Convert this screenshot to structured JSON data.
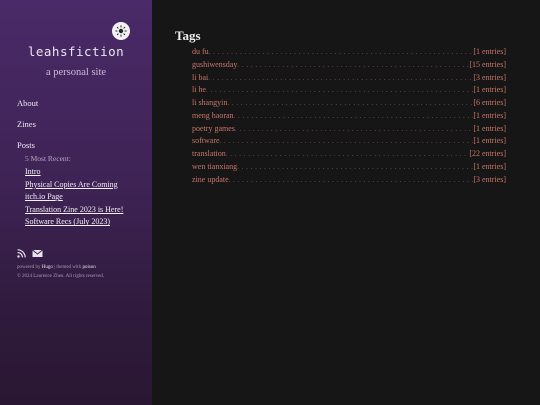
{
  "sidebar": {
    "site_title": "leahsfiction",
    "subtitle": "a personal site",
    "nav": {
      "about": "About",
      "zines": "Zines",
      "posts": "Posts"
    },
    "recent_label": "5 Most Recent:",
    "recent": [
      "Intro",
      "Physical Copies Are Coming",
      "itch.io Page",
      "Translation Zine 2023 is Here!",
      "Software Recs (July 2023)"
    ],
    "social_icons": [
      "rss-icon",
      "email-icon"
    ],
    "footer": {
      "powered_by": "powered by",
      "hugo": "Hugo",
      "themed_with": "| themed with",
      "poison": "poison",
      "copyright": "© 2024 Laurence Zhen. All rights reserved."
    }
  },
  "main": {
    "title": "Tags",
    "tags": [
      {
        "name": "du fu",
        "count": "[1 entries]"
      },
      {
        "name": "gushiwensday",
        "count": "[15 entries]"
      },
      {
        "name": "li bai",
        "count": "[3 entries]"
      },
      {
        "name": "li he",
        "count": "[1 entries]"
      },
      {
        "name": "li shangyin",
        "count": "[6 entries]"
      },
      {
        "name": "meng haoran",
        "count": "[1 entries]"
      },
      {
        "name": "poetry games",
        "count": "[1 entries]"
      },
      {
        "name": "software",
        "count": "[1 entries]"
      },
      {
        "name": "translation",
        "count": "[22 entries]"
      },
      {
        "name": "wen tianxiang",
        "count": "[1 entries]"
      },
      {
        "name": "zine update",
        "count": "[3 entries]"
      }
    ]
  },
  "colors": {
    "sidebar_top": "#4a2a68",
    "sidebar_bottom": "#2a1733",
    "background": "#161616",
    "tag_link": "#c9766a"
  }
}
